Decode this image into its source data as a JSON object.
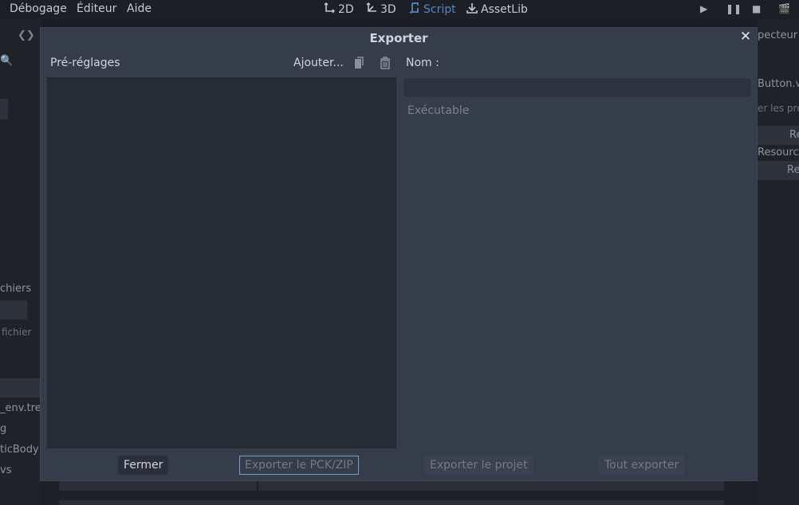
{
  "menu": {
    "items": [
      {
        "label": "Débogage"
      },
      {
        "label": "Éditeur"
      },
      {
        "label": "Aide"
      }
    ]
  },
  "workspaces": {
    "items": [
      {
        "label": "2D",
        "icon": "2d-move-icon"
      },
      {
        "label": "3D",
        "icon": "3d-move-icon"
      },
      {
        "label": "Script",
        "icon": "script-icon",
        "active": true
      },
      {
        "label": "AssetLib",
        "icon": "assetlib-icon"
      }
    ]
  },
  "background": {
    "left_tab": "chiers",
    "left_filter": "fichier",
    "left_files": [
      "_env.tre",
      "g",
      "ticBody",
      "vs"
    ],
    "right_tab": "pecteur",
    "right_file": "Button.v",
    "right_filter": "er les pro",
    "right_resource": "Resource",
    "right_re_1": "Re",
    "right_re_2": "Re"
  },
  "dialog": {
    "title": "Exporter",
    "presets_label": "Pré-réglages",
    "add_label": "Ajouter...",
    "name_label": "Nom :",
    "name_value": "",
    "executable_label": "Exécutable",
    "buttons": {
      "close": "Fermer",
      "export_pck": "Exporter le PCK/ZIP",
      "export_project": "Exporter le projet",
      "export_all": "Tout exporter"
    }
  },
  "colors": {
    "accent": "#5a83c4",
    "dialog_bg": "#363d4a",
    "list_bg": "#272b36",
    "focus_border": "#7d99c8"
  }
}
